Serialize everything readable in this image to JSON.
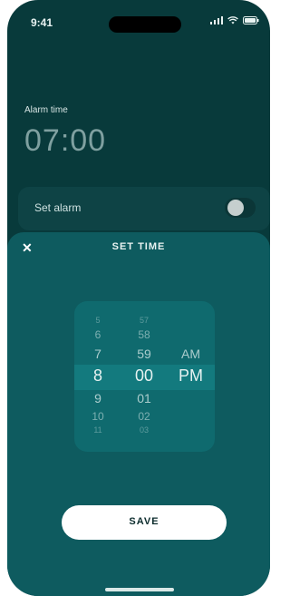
{
  "status_bar": {
    "time": "9:41"
  },
  "alarm": {
    "label": "Alarm time",
    "time": "07:00"
  },
  "set_alarm": {
    "label": "Set alarm",
    "enabled": false
  },
  "sheet": {
    "title": "SET TIME",
    "close_label": "✕"
  },
  "picker": {
    "hours": [
      "5",
      "6",
      "7",
      "8",
      "9",
      "10",
      "11"
    ],
    "minutes": [
      "57",
      "58",
      "59",
      "00",
      "01",
      "02",
      "03"
    ],
    "periods": [
      "AM",
      "PM"
    ],
    "selected": {
      "hour": "8",
      "minute": "00",
      "period": "PM"
    }
  },
  "actions": {
    "save_label": "SAVE"
  },
  "colors": {
    "background": "#083a3b",
    "sheet": "#0e5b5f",
    "picker": "#0f6a6e",
    "text": "#e9f3f2"
  }
}
